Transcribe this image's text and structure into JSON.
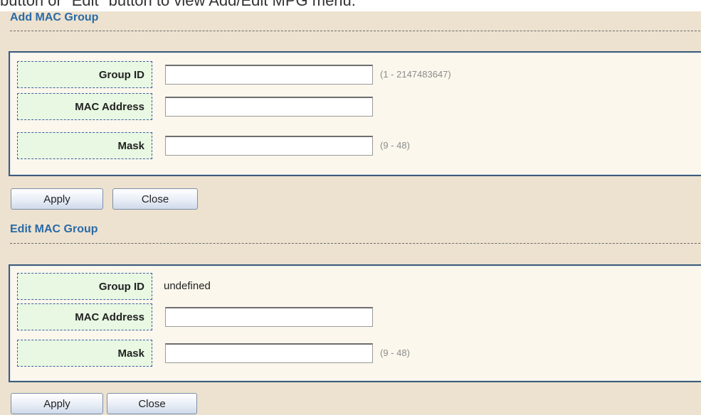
{
  "header_fragment": "button or \"Edit\" button to view Add/Edit MPG menu.",
  "add_group": {
    "title": "Add MAC Group",
    "group_id_label": "Group ID",
    "group_id_value": "",
    "group_id_hint": "(1 - 2147483647)",
    "mac_label": "MAC Address",
    "mac_value": "",
    "mask_label": "Mask",
    "mask_value": "",
    "mask_hint": "(9 - 48)",
    "apply_label": "Apply",
    "close_label": "Close"
  },
  "edit_group": {
    "title": "Edit MAC Group",
    "group_id_label": "Group ID",
    "group_id_value": "undefined",
    "mac_label": "MAC Address",
    "mac_value": "",
    "mask_label": "Mask",
    "mask_value": "",
    "mask_hint": "(9 - 48)",
    "apply_label": "Apply",
    "close_label": "Close"
  }
}
